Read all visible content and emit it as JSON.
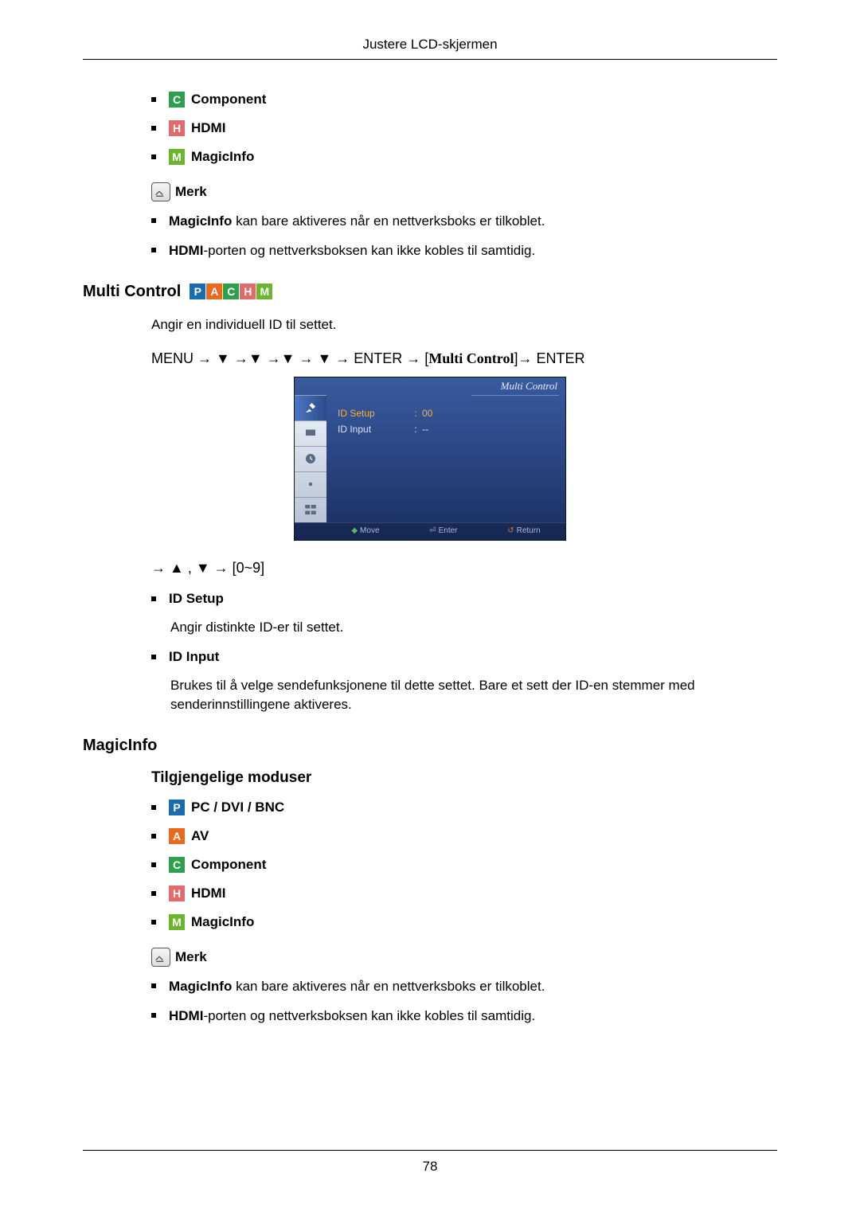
{
  "header": {
    "title": "Justere LCD-skjermen"
  },
  "footer": {
    "page": "78"
  },
  "modes_top": [
    {
      "badge": "C",
      "label": "Component"
    },
    {
      "badge": "H",
      "label": "HDMI"
    },
    {
      "badge": "M",
      "label": "MagicInfo"
    }
  ],
  "note_label": "Merk",
  "notes1": [
    {
      "bold": "MagicInfo",
      "rest": " kan bare aktiveres når en nettverksboks er tilkoblet."
    },
    {
      "bold": "HDMI",
      "rest": "-porten og nettverksboksen kan ikke kobles til samtidig."
    }
  ],
  "multi_control": {
    "heading": "Multi Control",
    "badges": [
      "P",
      "A",
      "C",
      "H",
      "M"
    ],
    "intro": "Angir en individuell ID til settet.",
    "path": {
      "p1": "MENU → ▼ →▼ →▼ → ▼ → ENTER → [",
      "mid": "Multi Control",
      "p2": "]→ ENTER"
    },
    "nav": "→ ▲ , ▼ → [0~9]",
    "items": [
      {
        "title": "ID Setup",
        "desc": "Angir distinkte ID-er til settet."
      },
      {
        "title": "ID Input",
        "desc": "Brukes til å velge sendefunksjonene til dette settet. Bare et sett der ID-en stemmer med senderinnstillingene aktiveres."
      }
    ]
  },
  "osd": {
    "title": "Multi Control",
    "rows": [
      {
        "label": "ID Setup",
        "value": "00",
        "active": true
      },
      {
        "label": "ID Input",
        "value": "--",
        "active": false
      }
    ],
    "footer": {
      "move": "Move",
      "enter": "Enter",
      "ret": "Return"
    }
  },
  "magicinfo": {
    "heading": "MagicInfo",
    "sub": "Tilgjengelige moduser",
    "modes": [
      {
        "badge": "P",
        "label": "PC / DVI / BNC"
      },
      {
        "badge": "A",
        "label": "AV"
      },
      {
        "badge": "C",
        "label": "Component"
      },
      {
        "badge": "H",
        "label": "HDMI"
      },
      {
        "badge": "M",
        "label": "MagicInfo"
      }
    ]
  },
  "notes2": [
    {
      "bold": "MagicInfo",
      "rest": " kan bare aktiveres når en nettverksboks er tilkoblet."
    },
    {
      "bold": "HDMI",
      "rest": "-porten og nettverksboksen kan ikke kobles til samtidig."
    }
  ]
}
